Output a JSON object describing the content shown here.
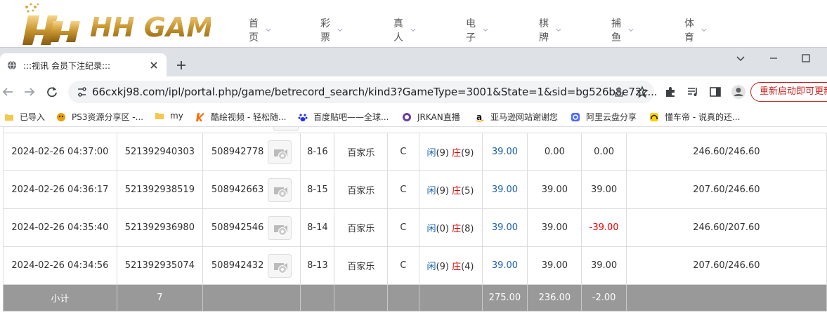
{
  "site": {
    "logo_text": "HH GAME",
    "nav": [
      {
        "label": "首页"
      },
      {
        "label": "彩票"
      },
      {
        "label": "真人"
      },
      {
        "label": "电子"
      },
      {
        "label": "棋牌"
      },
      {
        "label": "捕鱼"
      },
      {
        "label": "体育"
      }
    ]
  },
  "browser": {
    "tab_title": ":::视讯 会员下注纪录:::",
    "url": "66cxkj98.com/ipl/portal.php/game/betrecord_search/kind3?GameType=3001&State=1&sid=bg526b8e72c...",
    "restart_label": "重新启动即可更新",
    "bookmarks": [
      {
        "label": "已导入",
        "icon": "folder-icon"
      },
      {
        "label": "PS3资源分享区 -...",
        "icon": "ps3-icon"
      },
      {
        "label": "my",
        "icon": "folder-icon"
      },
      {
        "label": "酷绘视频 - 轻松随...",
        "icon": "k-icon"
      },
      {
        "label": "百度贴吧——全球...",
        "icon": "baidu-icon"
      },
      {
        "label": "JRKAN直播",
        "icon": "jrkan-icon"
      },
      {
        "label": "亚马逊网站谢谢您",
        "icon": "amazon-icon"
      },
      {
        "label": "阿里云盘分享",
        "icon": "aliyun-icon"
      },
      {
        "label": "懂车帝 - 说真的还...",
        "icon": "dongchedi-icon"
      }
    ]
  },
  "table": {
    "rows": [
      {
        "time": "2024-02-26 04:37:00",
        "bet_id": "521392940303",
        "round_id": "508942778",
        "table_no": "8-16",
        "game": "百家乐",
        "kind": "C",
        "player_label": "闲",
        "player_pts": "(9)",
        "banker_label": "庄",
        "banker_pts": "(9)",
        "bet": "39.00",
        "valid": "0.00",
        "win": "0.00",
        "balance": "246.60/246.60",
        "win_negative": false
      },
      {
        "time": "2024-02-26 04:36:17",
        "bet_id": "521392938519",
        "round_id": "508942663",
        "table_no": "8-15",
        "game": "百家乐",
        "kind": "C",
        "player_label": "闲",
        "player_pts": "(9)",
        "banker_label": "庄",
        "banker_pts": "(5)",
        "bet": "39.00",
        "valid": "39.00",
        "win": "39.00",
        "balance": "207.60/246.60",
        "win_negative": false
      },
      {
        "time": "2024-02-26 04:35:40",
        "bet_id": "521392936980",
        "round_id": "508942546",
        "table_no": "8-14",
        "game": "百家乐",
        "kind": "C",
        "player_label": "闲",
        "player_pts": "(0)",
        "banker_label": "庄",
        "banker_pts": "(8)",
        "bet": "39.00",
        "valid": "39.00",
        "win": "-39.00",
        "balance": "246.60/207.60",
        "win_negative": true
      },
      {
        "time": "2024-02-26 04:34:56",
        "bet_id": "521392935074",
        "round_id": "508942432",
        "table_no": "8-13",
        "game": "百家乐",
        "kind": "C",
        "player_label": "闲",
        "player_pts": "(9)",
        "banker_label": "庄",
        "banker_pts": "(4)",
        "bet": "39.00",
        "valid": "39.00",
        "win": "39.00",
        "balance": "207.60/246.60",
        "win_negative": false
      }
    ],
    "subtotal": {
      "label": "小计",
      "count": "7",
      "bet": "275.00",
      "valid": "236.00",
      "win": "-2.00"
    }
  },
  "colors": {
    "player": "#1a5fb4",
    "banker": "#d40000",
    "subtotal_bg": "#999999",
    "restart": "#c5221f"
  }
}
